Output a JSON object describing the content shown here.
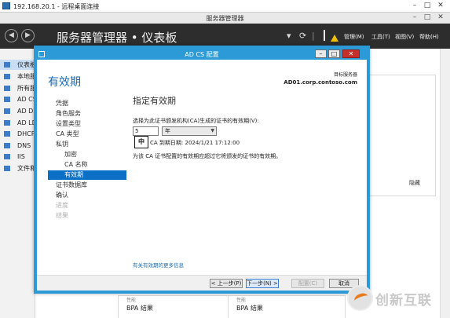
{
  "rdp": {
    "title": "192.168.20.1 - 远程桌面连接"
  },
  "server_manager": {
    "window_title": "服务器管理器",
    "breadcrumb": "服务器管理器 • 仪表板",
    "menu": [
      "管理(M)",
      "工具(T)",
      "视图(V)",
      "帮助(H)"
    ],
    "nav_items": [
      "仪表板",
      "本地服",
      "所有服",
      "AD CS",
      "AD DS",
      "AD LD",
      "DHCP",
      "DNS",
      "IIS",
      "文件和"
    ],
    "hide_label": "隐藏",
    "bpa_tiles": [
      {
        "top": "性能",
        "label": "BPA 结果"
      },
      {
        "top": "性能",
        "label": "BPA 结果"
      }
    ]
  },
  "dialog": {
    "title": "AD CS 配置",
    "heading": "有效期",
    "dest_label": "目标服务器",
    "dest_server": "AD01.corp.contoso.com",
    "steps": [
      {
        "label": "凭据",
        "state": "normal"
      },
      {
        "label": "角色服务",
        "state": "normal"
      },
      {
        "label": "设置类型",
        "state": "normal"
      },
      {
        "label": "CA 类型",
        "state": "normal"
      },
      {
        "label": "私钥",
        "state": "normal"
      },
      {
        "label": "加密",
        "state": "sub"
      },
      {
        "label": "CA 名称",
        "state": "sub"
      },
      {
        "label": "有效期",
        "state": "current"
      },
      {
        "label": "证书数据库",
        "state": "normal"
      },
      {
        "label": "确认",
        "state": "normal"
      },
      {
        "label": "进度",
        "state": "disabled"
      },
      {
        "label": "结果",
        "state": "disabled"
      }
    ],
    "pane": {
      "heading": "指定有效期",
      "prompt": "选择为此证书颁发机构(CA)生成的证书的有效期(V):",
      "period_value": "5",
      "period_unit": "年",
      "ime_indicator": "中",
      "expiry": "CA 到期日期: 2024/1/21 17:12:00",
      "note": "为该 CA 证书配置的有效期应超过它将颁发的证书的有效期。",
      "more_link": "有关有效期的更多信息"
    },
    "buttons": {
      "prev": "< 上一步(P)",
      "next": "下一步(N) >",
      "configure": "配置(C)",
      "cancel": "取消"
    }
  },
  "watermark": {
    "text": "创新互联"
  },
  "colors": {
    "accent": "#2d9ad8",
    "selection": "#0b6fc5",
    "header": "#2d2d2d"
  }
}
